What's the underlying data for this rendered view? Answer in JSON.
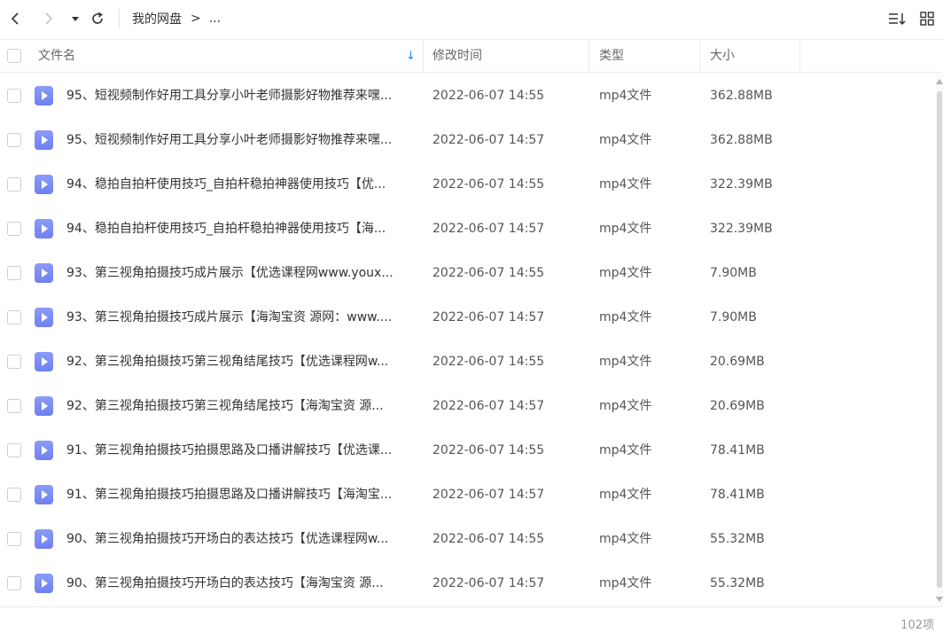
{
  "toolbar": {
    "back_icon": "chevron-left-icon",
    "forward_icon": "chevron-right-icon",
    "dropdown_icon": "caret-down-icon",
    "refresh_icon": "refresh-icon",
    "breadcrumb_root": "我的网盘",
    "breadcrumb_separator": ">",
    "breadcrumb_more": "...",
    "sort_icon": "sort-list-icon",
    "view_icon": "grid-view-icon"
  },
  "header": {
    "name": "文件名",
    "modified": "修改时间",
    "type": "类型",
    "size": "大小",
    "sort_indicator": "↓"
  },
  "files": [
    {
      "name": "95、短视频制作好用工具分享小叶老师摄影好物推荐来嘿...",
      "time": "2022-06-07 14:55",
      "type": "mp4文件",
      "size": "362.88MB"
    },
    {
      "name": "95、短视频制作好用工具分享小叶老师摄影好物推荐来嘿...",
      "time": "2022-06-07 14:57",
      "type": "mp4文件",
      "size": "362.88MB"
    },
    {
      "name": "94、稳拍自拍杆使用技巧_自拍杆稳拍神器使用技巧【优...",
      "time": "2022-06-07 14:55",
      "type": "mp4文件",
      "size": "322.39MB"
    },
    {
      "name": "94、稳拍自拍杆使用技巧_自拍杆稳拍神器使用技巧【海...",
      "time": "2022-06-07 14:57",
      "type": "mp4文件",
      "size": "322.39MB"
    },
    {
      "name": "93、第三视角拍摄技巧成片展示【优选课程网www.youx...",
      "time": "2022-06-07 14:55",
      "type": "mp4文件",
      "size": "7.90MB"
    },
    {
      "name": "93、第三视角拍摄技巧成片展示【海淘宝资 源网：www....",
      "time": "2022-06-07 14:57",
      "type": "mp4文件",
      "size": "7.90MB"
    },
    {
      "name": "92、第三视角拍摄技巧第三视角结尾技巧【优选课程网w...",
      "time": "2022-06-07 14:55",
      "type": "mp4文件",
      "size": "20.69MB"
    },
    {
      "name": "92、第三视角拍摄技巧第三视角结尾技巧【海淘宝资 源...",
      "time": "2022-06-07 14:57",
      "type": "mp4文件",
      "size": "20.69MB"
    },
    {
      "name": "91、第三视角拍摄技巧拍摄思路及口播讲解技巧【优选课...",
      "time": "2022-06-07 14:55",
      "type": "mp4文件",
      "size": "78.41MB"
    },
    {
      "name": "91、第三视角拍摄技巧拍摄思路及口播讲解技巧【海淘宝...",
      "time": "2022-06-07 14:57",
      "type": "mp4文件",
      "size": "78.41MB"
    },
    {
      "name": "90、第三视角拍摄技巧开场白的表达技巧【优选课程网w...",
      "time": "2022-06-07 14:55",
      "type": "mp4文件",
      "size": "55.32MB"
    },
    {
      "name": "90、第三视角拍摄技巧开场白的表达技巧【海淘宝资 源...",
      "time": "2022-06-07 14:57",
      "type": "mp4文件",
      "size": "55.32MB"
    }
  ],
  "footer": {
    "count": "102项"
  },
  "colors": {
    "accent": "#1e88e5",
    "file_icon": "#7b8cf5"
  }
}
